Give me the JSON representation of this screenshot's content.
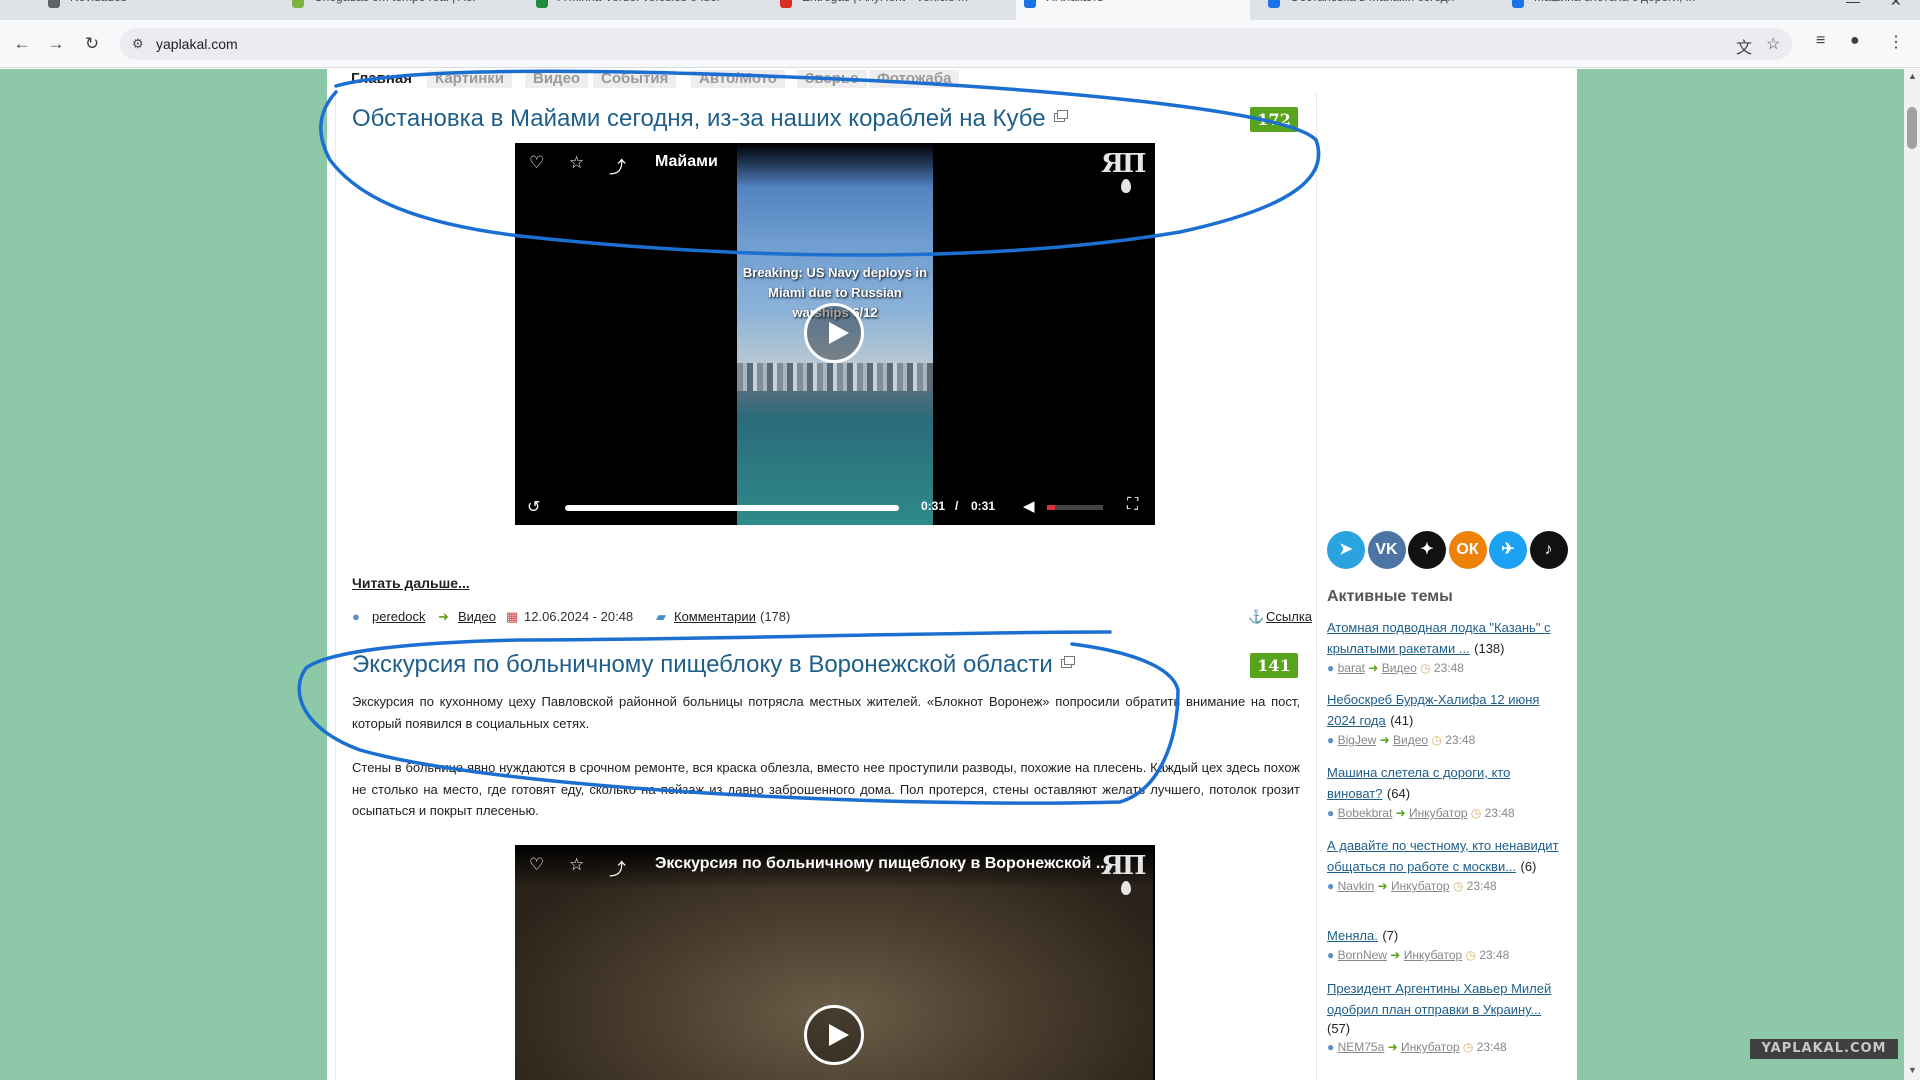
{
  "browser": {
    "tabs": [
      {
        "label": "Novidades",
        "color": "#5f6368"
      },
      {
        "label": "Chegadas em tempo real | Aer",
        "color": "#7cb342"
      },
      {
        "label": "A minha Verde: veículos e fuer",
        "color": "#1e8e3e"
      },
      {
        "label": "Entregas | AnyRent - Vehicle m",
        "color": "#d93025"
      },
      {
        "label": "ЯПлакалъ",
        "color": "#1a73e8"
      },
      {
        "label": "Обстановка в Майами сегодн",
        "color": "#1a73e8"
      },
      {
        "label": "Машина слетела с дороги, кт",
        "color": "#1a73e8"
      }
    ],
    "active_tab_index": 4,
    "url": "yaplakal.com"
  },
  "site": {
    "nav": [
      "Главная",
      "Картинки",
      "Видео",
      "События",
      "Авто/Мото",
      "Зверье",
      "Фотожаба"
    ],
    "active_nav_index": 0,
    "watermark": "YAPLAKAL.COM"
  },
  "posts": [
    {
      "title": "Обстановка в Майами сегодня, из-за наших кораблей на Кубе",
      "score": "172",
      "video": {
        "title": "Майами",
        "overlay_text": "Breaking: US Navy deploys in Miami due to Russian warships 6/12",
        "time_current": "0:31",
        "time_separator": "/",
        "time_total": "0:31",
        "progress": 1.0,
        "volume": 0.15
      },
      "readmore": "Читать дальше...",
      "meta": {
        "author": "peredock",
        "category": "Видео",
        "date": "12.06.2024 - 20:48",
        "comments_label": "Комментарии",
        "comments_count": "(178)",
        "link_label": "Ссылка"
      }
    },
    {
      "title": "Экскурсия по больничному пищеблоку в Воронежской области",
      "score": "141",
      "paragraphs": [
        "Экскурсия по кухонному цеху Павловской районной больницы потрясла местных жителей. «Блокнот Воронеж» попросили обратить внимание на пост, который появился в социальных сетях.",
        "Стены в больнице явно нуждаются в срочном ремонте, вся краска облезла, вместо нее проступили разводы, похожие на плесень. Каждый цех здесь похож не столько на место, где готовят еду, сколько на пейзаж из давно заброшенного дома. Пол протерся, стены оставляют желать лучшего, потолок грозит осыпаться и покрыт плесенью."
      ],
      "video": {
        "title": "Экскурсия по больничному пищеблоку в Воронежской ..."
      }
    }
  ],
  "sidebar": {
    "social": [
      {
        "name": "telegram",
        "glyph": "➤",
        "color": "#2aa3df"
      },
      {
        "name": "vk",
        "glyph": "VK",
        "color": "#4c75a3"
      },
      {
        "name": "zen",
        "glyph": "✦",
        "color": "#111111"
      },
      {
        "name": "odnoklassniki",
        "glyph": "ОК",
        "color": "#ee8208"
      },
      {
        "name": "twitter",
        "glyph": "✈",
        "color": "#1da1f2"
      },
      {
        "name": "tiktok",
        "glyph": "♪",
        "color": "#111111"
      }
    ],
    "active_title": "Активные темы",
    "topics": [
      {
        "title": "Атомная подводная лодка \"Казань\" с крылатыми ракетами ...",
        "count": "(138)",
        "author": "barat",
        "category": "Видео",
        "time": "23:48"
      },
      {
        "title": "Небоскреб Бурдж-Халифа 12 июня 2024 года",
        "count": "(41)",
        "author": "BigJew",
        "category": "Видео",
        "time": "23:48"
      },
      {
        "title": "Машина слетела с дороги, кто виноват?",
        "count": "(64)",
        "author": "Bobekbrat",
        "category": "Инкубатор",
        "time": "23:48"
      },
      {
        "title": "А давайте по честному, кто ненавидит общаться по работе с москви...",
        "count": "(6)",
        "author": "Navkin",
        "category": "Инкубатор",
        "time": "23:48"
      },
      {
        "title": "Меняла.",
        "count": "(7)",
        "author": "BornNew",
        "category": "Инкубатор",
        "time": "23:48"
      },
      {
        "title": "Президент Аргентины Хавьер Милей одобрил план отправки в Украину...",
        "count": "(57)",
        "author": "NEM75a",
        "category": "Инкубатор",
        "time": "23:48"
      }
    ]
  },
  "colors": {
    "page_bg": "#8dc8a8",
    "title_link": "#1f5f8a",
    "score_badge": "#58a41d",
    "annotation_ink": "#1a6fd0"
  }
}
